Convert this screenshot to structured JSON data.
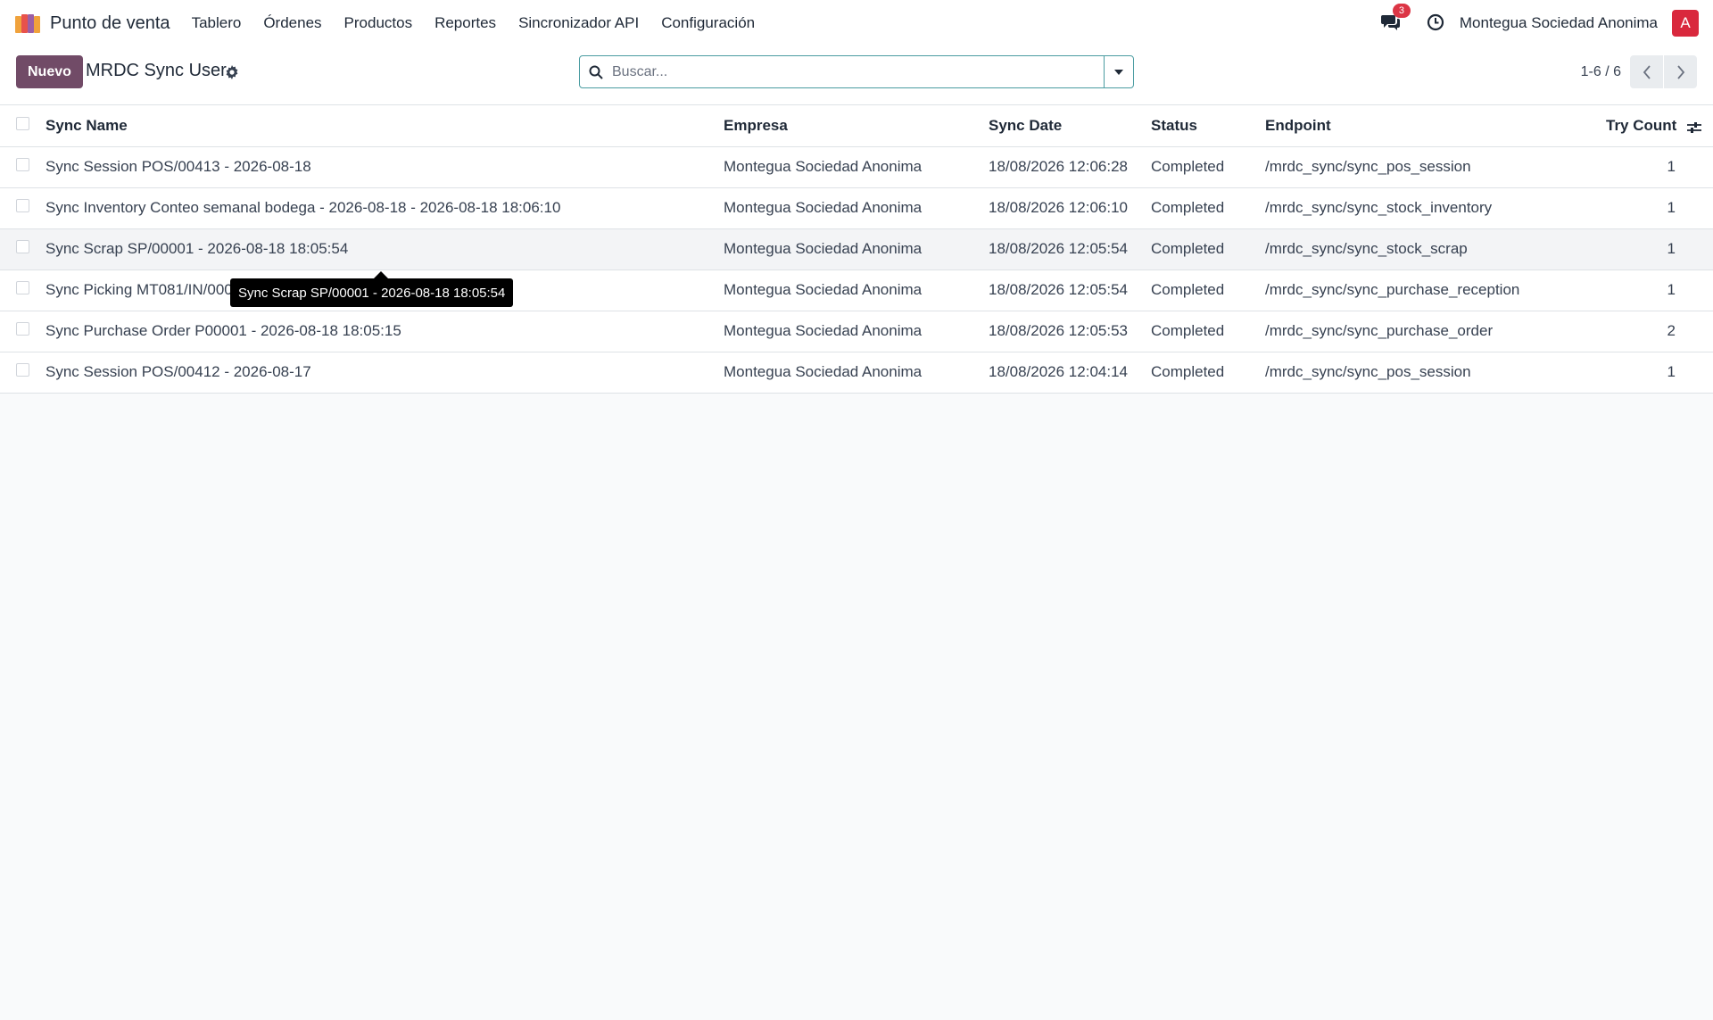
{
  "navbar": {
    "app_name": "Punto de venta",
    "menu": [
      "Tablero",
      "Órdenes",
      "Productos",
      "Reportes",
      "Sincronizador API",
      "Configuración"
    ],
    "messages_count": "3",
    "company": "Montegua Sociedad Anonima",
    "avatar_initial": "A"
  },
  "control_panel": {
    "new_button": "Nuevo",
    "title": "MRDC Sync User",
    "search_placeholder": "Buscar...",
    "pager": "1-6 / 6"
  },
  "table": {
    "columns": [
      "Sync Name",
      "Empresa",
      "Sync Date",
      "Status",
      "Endpoint",
      "Try Count"
    ],
    "rows": [
      {
        "name": "Sync Session POS/00413 - 2026-08-18",
        "company": "Montegua Sociedad Anonima",
        "date": "18/08/2026 12:06:28",
        "status": "Completed",
        "endpoint": "/mrdc_sync/sync_pos_session",
        "tries": "1"
      },
      {
        "name": "Sync Inventory Conteo semanal bodega - 2026-08-18 - 2026-08-18 18:06:10",
        "company": "Montegua Sociedad Anonima",
        "date": "18/08/2026 12:06:10",
        "status": "Completed",
        "endpoint": "/mrdc_sync/sync_stock_inventory",
        "tries": "1"
      },
      {
        "name": "Sync Scrap SP/00001 - 2026-08-18 18:05:54",
        "company": "Montegua Sociedad Anonima",
        "date": "18/08/2026 12:05:54",
        "status": "Completed",
        "endpoint": "/mrdc_sync/sync_stock_scrap",
        "tries": "1"
      },
      {
        "name": "Sync Picking MT081/IN/000",
        "company": "Montegua Sociedad Anonima",
        "date": "18/08/2026 12:05:54",
        "status": "Completed",
        "endpoint": "/mrdc_sync/sync_purchase_reception",
        "tries": "1"
      },
      {
        "name": "Sync Purchase Order P00001 - 2026-08-18 18:05:15",
        "company": "Montegua Sociedad Anonima",
        "date": "18/08/2026 12:05:53",
        "status": "Completed",
        "endpoint": "/mrdc_sync/sync_purchase_order",
        "tries": "2"
      },
      {
        "name": "Sync Session POS/00412 - 2026-08-17",
        "company": "Montegua Sociedad Anonima",
        "date": "18/08/2026 12:04:14",
        "status": "Completed",
        "endpoint": "/mrdc_sync/sync_pos_session",
        "tries": "1"
      }
    ]
  },
  "tooltip": {
    "text": "Sync Scrap SP/00001 - 2026-08-18 18:05:54"
  },
  "colors": {
    "primary": "#714b67",
    "badge": "#dc3545",
    "avatar": "#d9283d",
    "search_border": "#4a9ca1"
  }
}
